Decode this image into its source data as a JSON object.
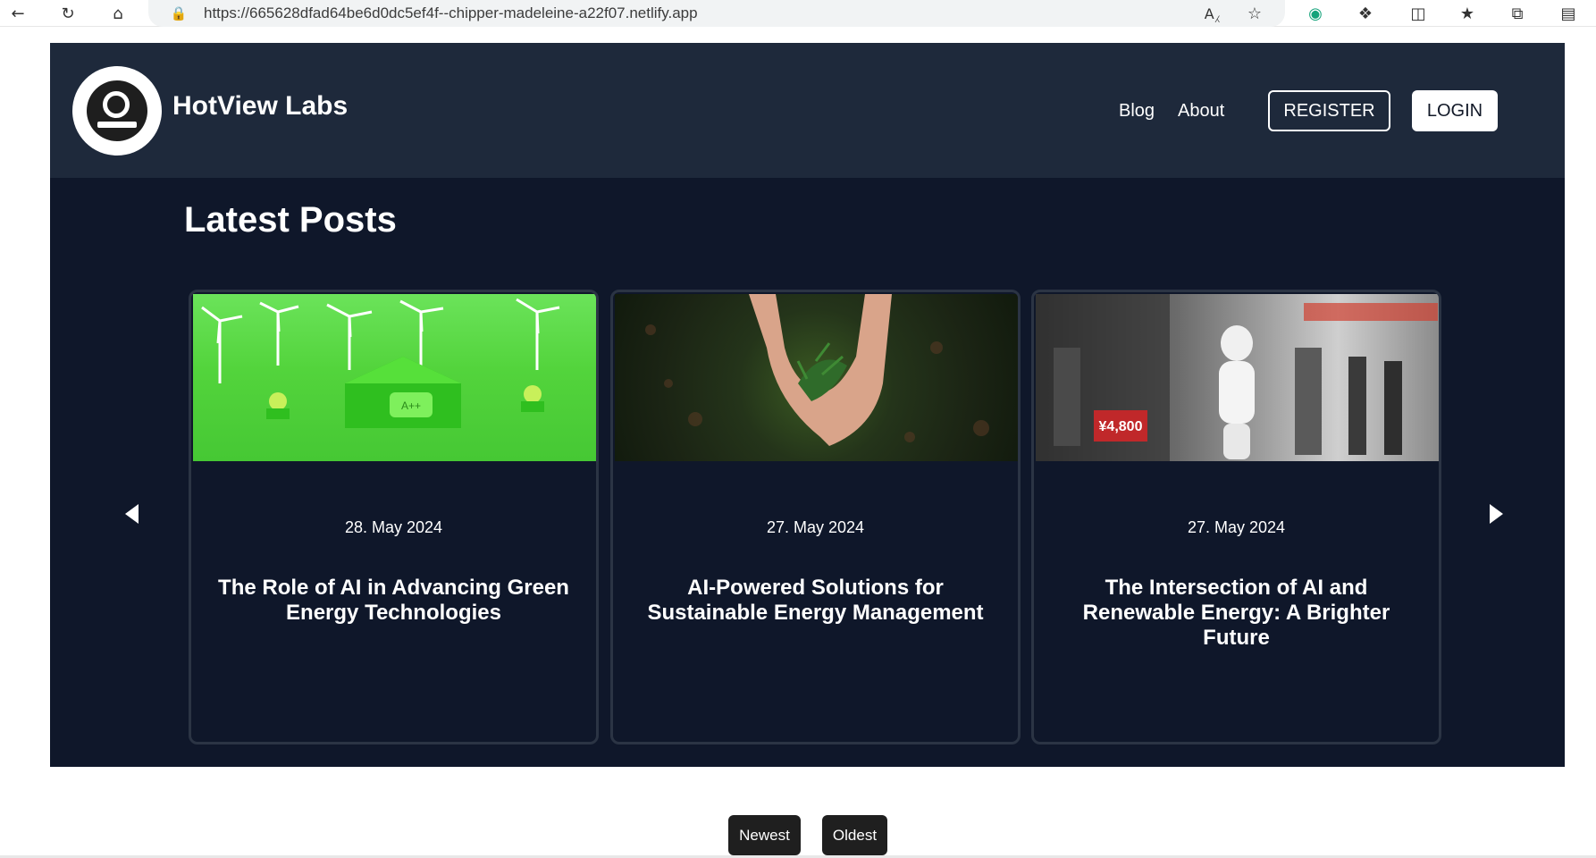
{
  "browser": {
    "url": "https://665628dfad64be6d0dc5ef4f--chipper-madeleine-a22f07.netlify.app"
  },
  "header": {
    "brand": "HotView Labs",
    "nav": {
      "blog": "Blog",
      "about": "About"
    },
    "register": "REGISTER",
    "login": "LOGIN"
  },
  "section": {
    "title": "Latest Posts"
  },
  "posts": [
    {
      "date": "28. May 2024",
      "title": "The Role of AI in Advancing Green Energy Technologies"
    },
    {
      "date": "27. May 2024",
      "title": "AI-Powered Solutions for Sustainable Energy Management"
    },
    {
      "date": "27. May 2024",
      "title": "The Intersection of AI and Renewable Energy: A Brighter Future"
    }
  ],
  "sort": {
    "newest": "Newest",
    "oldest": "Oldest"
  },
  "colors": {
    "header_bg": "#1e293b",
    "body_bg": "#0f172a",
    "button_dark": "#1f1f1f"
  }
}
